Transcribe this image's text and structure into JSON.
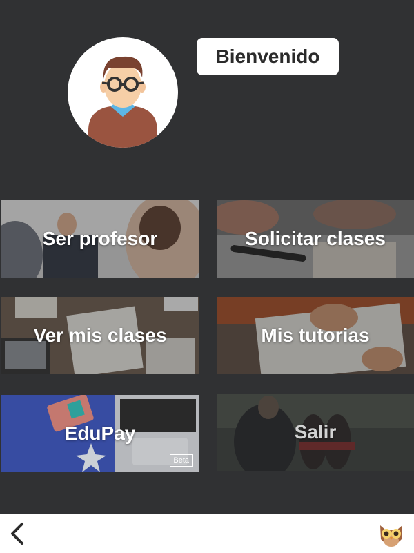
{
  "header": {
    "welcome_label": "Bienvenido"
  },
  "menu": {
    "ser_profesor": "Ser profesor",
    "solicitar_clases": "Solicitar clases",
    "ver_mis_clases": "Ver mis clases",
    "mis_tutorias": "Mis tutorias",
    "edupay": "EduPay",
    "edupay_badge": "Beta",
    "salir": "Salir"
  },
  "icons": {
    "back": "chevron-left-icon",
    "logo": "owl-icon",
    "avatar": "teacher-avatar"
  },
  "colors": {
    "background": "#303133",
    "bottom_bar": "#ffffff",
    "edupay_blue": "#3a53b8"
  }
}
